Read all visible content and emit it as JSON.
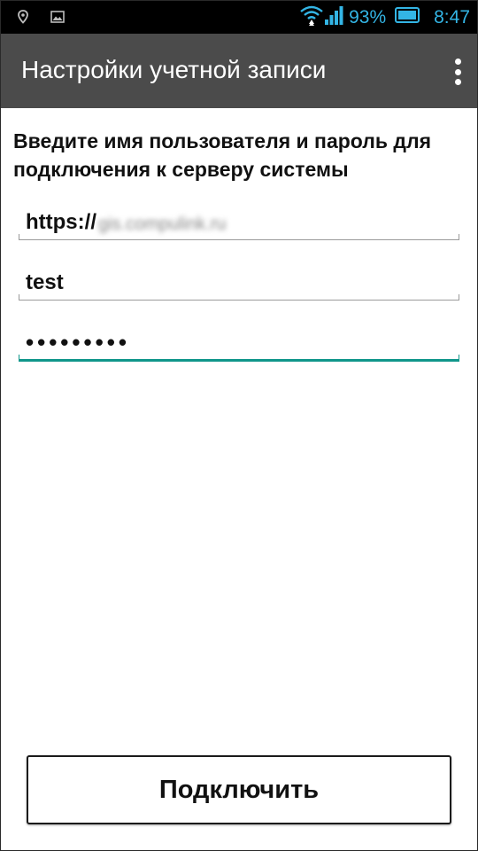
{
  "status_bar": {
    "icons_left": [
      "location-icon",
      "image-notification-icon"
    ],
    "icons_right": [
      "wifi-icon",
      "signal-icon",
      "battery-icon"
    ],
    "battery_percent": "93%",
    "time": "8:47",
    "accent_color": "#33b5e5"
  },
  "action_bar": {
    "title": "Настройки учетной записи",
    "background_color": "#4b4b4b",
    "menu_icon": "overflow-menu-icon"
  },
  "form": {
    "instruction": "Введите имя пользователя и пароль для подключения к серверу системы",
    "url_prefix": "https://",
    "url_host_blurred": "gis.compulink.ru",
    "username": "test",
    "password_masked": "•••••••••",
    "focus_color": "#10968a"
  },
  "actions": {
    "connect_label": "Подключить"
  }
}
